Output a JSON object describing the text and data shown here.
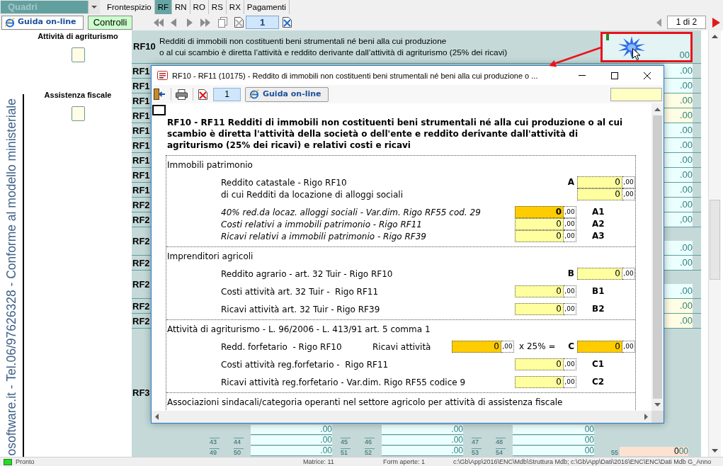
{
  "top_bar": {
    "section_select": {
      "value": "Quadri",
      "disabled": true
    },
    "tabs": [
      {
        "label": "Frontespizio",
        "selected": false
      },
      {
        "label": "RF",
        "selected": true
      },
      {
        "label": "RN",
        "selected": false
      },
      {
        "label": "RO",
        "selected": false
      },
      {
        "label": "RS",
        "selected": false
      },
      {
        "label": "RX",
        "selected": false
      },
      {
        "label": "Pagamenti",
        "selected": false
      }
    ]
  },
  "toolbar": {
    "help_button": "Guida on-line",
    "check_button": "Controlli",
    "page_field": "1",
    "page_indicator": "1 di 2"
  },
  "sidebar": {
    "options": [
      {
        "label": "Attività di agriturismo",
        "checked": false
      },
      {
        "label": "Assistenza fiscale",
        "checked": false
      }
    ],
    "vertical_note": "osoftware.it - Tel.06/97626328 - Conforme al modello ministeriale"
  },
  "form": {
    "header_row": {
      "code": "RF10",
      "lines": [
        "Redditi di immobili non costituenti beni strumentali né beni alla cui produzione",
        "o al cui scambio è diretta l’attività e reddito derivante dall’attività di agriturismo (25% dei ricavi)"
      ],
      "value": "00"
    },
    "rows": [
      {
        "kind": "line",
        "code": "RF1",
        "value": ".00",
        "editable": false
      },
      {
        "kind": "line",
        "code": "RF1",
        "value": ".00",
        "editable": false
      },
      {
        "kind": "line",
        "code": "RF1",
        "value": ".00",
        "editable": true
      },
      {
        "kind": "line",
        "code": "RF1",
        "value": ".00",
        "editable": true
      },
      {
        "kind": "line",
        "code": "RF1",
        "value": ".00",
        "editable": false
      },
      {
        "kind": "line",
        "code": "RF1",
        "value": ".00",
        "editable": false
      },
      {
        "kind": "line",
        "code": "RF1",
        "value": ".00",
        "editable": false
      },
      {
        "kind": "line",
        "code": "RF1",
        "value": ".00",
        "editable": false
      },
      {
        "kind": "line",
        "code": "RF1",
        "value": ".00",
        "editable": false
      },
      {
        "kind": "line",
        "code": "RF2",
        "value": ".00",
        "editable": false
      },
      {
        "kind": "line",
        "code": "RF2",
        "value": ",00",
        "editable": false
      },
      {
        "kind": "tall",
        "code": "RF2",
        "value": ".00",
        "editable": false
      },
      {
        "kind": "line",
        "code": "RF2",
        "value": ".00",
        "editable": false
      },
      {
        "kind": "tall",
        "code": "RF2",
        "value": ".00",
        "editable": false
      },
      {
        "kind": "line",
        "code": "RF2",
        "value": ".00",
        "editable": true
      },
      {
        "kind": "line",
        "code": "RF2",
        "value": ".00",
        "editable": true
      }
    ],
    "last_row": {
      "code": "RF3",
      "strips": [
        {
          "cells": [
            {
              "value": ".00"
            },
            {
              "value": ".00"
            },
            {
              "value": "00"
            }
          ]
        },
        {
          "cells": [
            {
              "numbers": [
                "43",
                "44"
              ],
              "value": ".00"
            },
            {
              "numbers": [
                "45",
                "46"
              ],
              "value": ".00"
            },
            {
              "numbers": [
                "47",
                "48"
              ],
              "value": "00"
            }
          ]
        },
        {
          "cells": [
            {
              "numbers": [
                "49",
                "50"
              ],
              "value": ".00"
            },
            {
              "numbers": [
                "51",
                "52"
              ],
              "value": ".00"
            },
            {
              "numbers": [
                "53",
                "54"
              ],
              "value": "00"
            }
          ],
          "extra": {
            "number": "55",
            "value": "0",
            "decimals": "00"
          }
        }
      ]
    }
  },
  "dialog": {
    "title": "RF10 - RF11 (10175) - Reddito di immobili non costituenti beni strumentali né beni alla cui produzione o ...",
    "toolbar": {
      "page_field": "1",
      "help_button": "Guida on-line"
    },
    "heading": "RF10 - RF11 Redditi di immobili non costituenti beni strumentali né alla cui produzione o al cui scambio è diretta l'attività della società o dell'ente e reddito derivante dall'attività di agriturismo (25% dei ricavi) e relativi costi e ricavi",
    "sections": [
      {
        "title": "Immobili patrimonio",
        "groups": [
          {
            "rows": [
              {
                "kind": "total",
                "text": "Reddito catastale - Rigo RF10",
                "italic": false,
                "code": "A",
                "field": {
                  "value": "0",
                  "decimals": ",00",
                  "highlighted": false,
                  "focused": false
                }
              },
              {
                "kind": "total",
                "text": "di cui Redditi da locazione di alloggi sociali",
                "italic": false,
                "field": {
                  "value": "0",
                  "decimals": ",00",
                  "highlighted": false,
                  "focused": false
                }
              }
            ]
          },
          {
            "rows": [
              {
                "kind": "detail",
                "text": "40% red.da locaz. alloggi sociali - Var.dim. Rigo RF55 cod. 29",
                "italic": true,
                "code": "A1",
                "field": {
                  "value": "0",
                  "decimals": ",00",
                  "highlighted": true,
                  "focused": true
                }
              },
              {
                "kind": "detail",
                "text": "Costi relativi a immobili patrimonio - Rigo RF11",
                "italic": true,
                "code": "A2",
                "field": {
                  "value": "0",
                  "decimals": ",00",
                  "highlighted": false,
                  "focused": false
                }
              },
              {
                "kind": "detail",
                "text": "Ricavi relativi a immobili patrimonio - Rigo RF39",
                "italic": true,
                "code": "A3",
                "field": {
                  "value": "0",
                  "decimals": ",00",
                  "highlighted": false,
                  "focused": false
                }
              }
            ]
          }
        ]
      },
      {
        "title": "Imprenditori agricoli",
        "groups": [
          {
            "rows": [
              {
                "kind": "total",
                "text": "Reddito agrario - art. 32 Tuir - Rigo RF10",
                "italic": false,
                "code": "B",
                "field": {
                  "value": "0",
                  "decimals": ",00",
                  "highlighted": false,
                  "focused": false
                }
              }
            ]
          },
          {
            "rows": [
              {
                "kind": "detail",
                "text": "Costi attività art. 32 Tuir -  Rigo RF11",
                "italic": false,
                "code": "B1",
                "field": {
                  "value": "0",
                  "decimals": ",00",
                  "highlighted": false,
                  "focused": false
                }
              }
            ]
          },
          {
            "rows": [
              {
                "kind": "detail",
                "text": "Ricavi attività art. 32 Tuir - Rigo RF39",
                "italic": false,
                "code": "B2",
                "field": {
                  "value": "0",
                  "decimals": ",00",
                  "highlighted": false,
                  "focused": false
                }
              }
            ]
          }
        ]
      },
      {
        "title": "Attività di agriturismo - L. 96/2006 - L. 413/91 art. 5 comma 1",
        "groups": [
          {
            "rows": [
              {
                "kind": "formula",
                "text": "Redd. forfetario  - Rigo RF10",
                "italic": false,
                "input_label": "Ricavi attività",
                "input": {
                  "value": "0",
                  "decimals": ",00",
                  "highlighted": true,
                  "focused": false
                },
                "operator": "x 25% =",
                "code": "C",
                "field": {
                  "value": "0",
                  "decimals": ",00",
                  "highlighted": true,
                  "focused": false
                }
              }
            ]
          },
          {
            "rows": [
              {
                "kind": "detail",
                "text": "Costi attività reg.forfetario -  Rigo RF11",
                "italic": false,
                "code": "C1",
                "field": {
                  "value": "0",
                  "decimals": ",00",
                  "highlighted": false,
                  "focused": false
                }
              }
            ]
          },
          {
            "rows": [
              {
                "kind": "detail",
                "text": "Ricavi attività reg.forfetario - Var.dim. Rigo RF55 codice 9",
                "italic": false,
                "code": "C2",
                "field": {
                  "value": "0",
                  "decimals": ",00",
                  "highlighted": false,
                  "focused": false
                }
              }
            ]
          }
        ]
      },
      {
        "title": "Associazioni sindacali/categoria operanti nel settore agricolo per attività di assistenza fiscale"
      }
    ]
  },
  "status_bar": {
    "items": [
      "Pronto",
      "Matrice: 11",
      "Form aperte: 1",
      "c:\\Gb\\App\\2016\\ENC\\Mdb\\Struttura Mdb; c:\\Gb\\App\\Dati\\2016\\ENC\\ENC\\Dati Mdb G_Anno"
    ]
  }
}
